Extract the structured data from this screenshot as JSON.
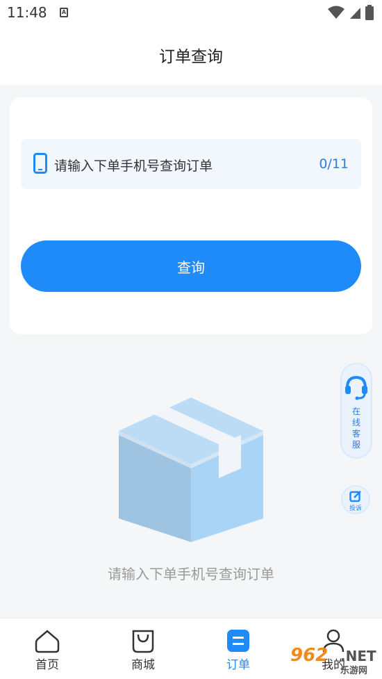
{
  "status_bar": {
    "time": "11:48",
    "notification_icon": "A"
  },
  "header": {
    "title": "订单查询"
  },
  "search": {
    "placeholder": "请输入下单手机号查询订单",
    "counter": "0/11",
    "button_label": "查询"
  },
  "empty_state": {
    "message": "请输入下单手机号查询订单"
  },
  "floating": {
    "service_label": "在线客服",
    "service_chars": [
      "在",
      "线",
      "客",
      "服"
    ],
    "complaint_label": "投诉"
  },
  "bottom_nav": {
    "items": [
      {
        "label": "首页",
        "icon": "home-icon",
        "active": false
      },
      {
        "label": "商城",
        "icon": "bag-icon",
        "active": false
      },
      {
        "label": "订单",
        "icon": "order-icon",
        "active": true
      },
      {
        "label": "我的",
        "icon": "user-icon",
        "active": false
      }
    ]
  },
  "watermark": {
    "number": "962",
    "domain": ".NET",
    "site": "乐游网"
  },
  "colors": {
    "accent": "#1f8bf9",
    "background": "#f5f6f8",
    "input_bg": "#f2f6fd",
    "box_light": "#a9d4f5"
  }
}
